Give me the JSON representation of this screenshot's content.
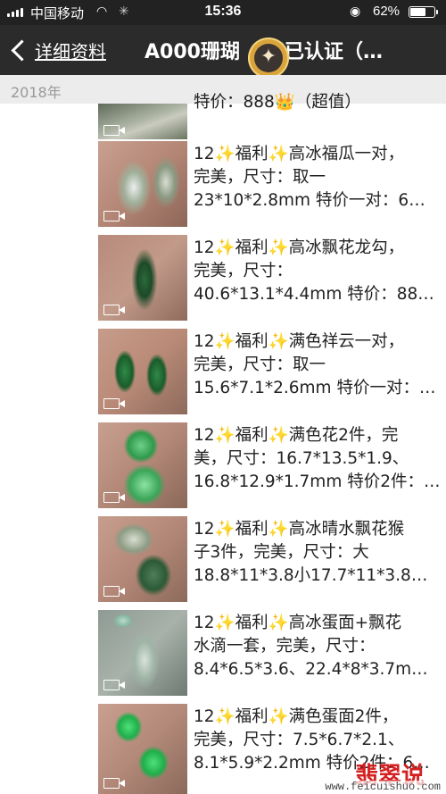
{
  "status_bar": {
    "carrier": "中国移动",
    "time": "15:36",
    "battery_pct": "62%",
    "battery_level": 0.62
  },
  "nav": {
    "back_label": "详细资料",
    "title_prefix": "A000珊瑚",
    "title_suffix": "已认证（…"
  },
  "section": {
    "year": "2018年"
  },
  "posts": [
    {
      "lines": [
        "特价：888👑（超值）"
      ]
    },
    {
      "lines": [
        "12✨福利✨高冰福瓜一对，",
        "完美，尺寸：取一",
        "23*10*2.8mm 特价一对：6…"
      ]
    },
    {
      "lines": [
        "12✨福利✨高冰飘花龙勾，",
        "完美，尺寸：",
        "40.6*13.1*4.4mm 特价：88…"
      ]
    },
    {
      "lines": [
        "12✨福利✨满色祥云一对，",
        "完美，尺寸：取一",
        "15.6*7.1*2.6mm 特价一对：…"
      ]
    },
    {
      "lines": [
        "12✨福利✨满色花2件，完",
        "美，尺寸：16.7*13.5*1.9、",
        "16.8*12.9*1.7mm 特价2件：…"
      ]
    },
    {
      "lines": [
        "12✨福利✨高冰晴水飘花猴",
        "子3件，完美，尺寸：大",
        "18.8*11*3.8小17.7*11*3.8m…"
      ]
    },
    {
      "lines": [
        "12✨福利✨高冰蛋面+飘花",
        "水滴一套，完美，尺寸：",
        "8.4*6.5*3.6、22.4*8*3.7m…"
      ]
    },
    {
      "lines": [
        "12✨福利✨满色蛋面2件，",
        "完美，尺寸：7.5*6.7*2.1、",
        "8.1*5.9*2.2mm 特价2件：6…"
      ]
    }
  ],
  "watermark": {
    "brand": "翡翠说",
    "url": "www.feicuishuo.com"
  },
  "colors": {
    "nav_bg": "#2b2b2b",
    "status_bg": "#222222",
    "section_bg": "#ececec",
    "verified_green": "#4fb84b",
    "watermark_red": "#d42020"
  }
}
